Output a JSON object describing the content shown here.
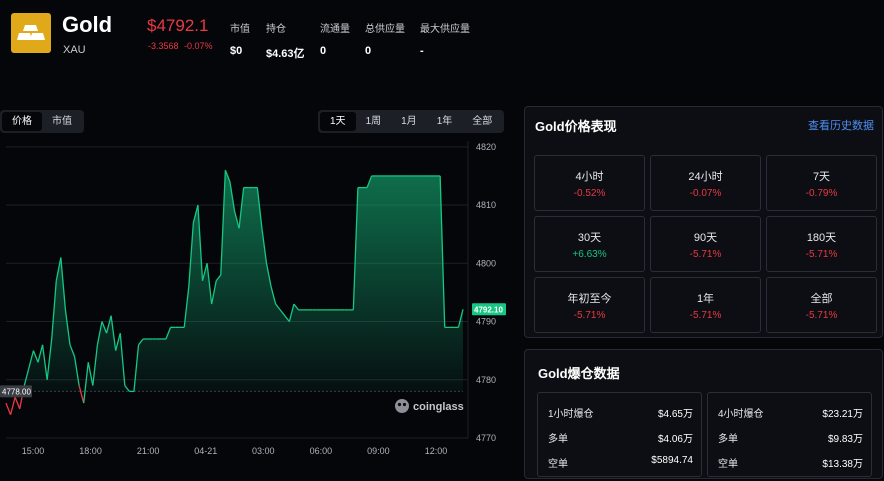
{
  "header": {
    "name": "Gold",
    "symbol": "XAU",
    "price": "$4792.1",
    "change_abs": "-3.3568",
    "change_pct": "-0.07%",
    "stats": [
      {
        "label": "市值",
        "value": "$0"
      },
      {
        "label": "持仓",
        "value": "$4.63亿"
      },
      {
        "label": "流通量",
        "value": "0"
      },
      {
        "label": "总供应量",
        "value": "0"
      },
      {
        "label": "最大供应量",
        "value": "-"
      }
    ]
  },
  "chart_tabs": {
    "price": "价格",
    "market_cap": "市值"
  },
  "range_tabs": [
    "1天",
    "1周",
    "1月",
    "1年",
    "全部"
  ],
  "watermark": "coinglass",
  "chart_data": {
    "type": "area",
    "x_ticks": [
      "15:00",
      "18:00",
      "21:00",
      "04-21",
      "03:00",
      "06:00",
      "09:00",
      "12:00"
    ],
    "y_ticks": [
      4820,
      4810,
      4800,
      4790,
      4780,
      4770
    ],
    "ylim": [
      4770,
      4821
    ],
    "baseline": 4778.0,
    "baseline_label": "4778.00",
    "last_label": "4792.10",
    "values": [
      4776,
      4774,
      4777,
      4775,
      4779,
      4782,
      4785,
      4783,
      4786,
      4780,
      4787,
      4797,
      4801,
      4792,
      4786,
      4784,
      4779,
      4776,
      4783,
      4779,
      4786,
      4790,
      4788,
      4791,
      4785,
      4788,
      4779,
      4778,
      4778,
      4786,
      4787,
      4787,
      4787,
      4787,
      4787,
      4787,
      4789,
      4789,
      4789,
      4789,
      4796,
      4807,
      4810,
      4797,
      4800,
      4793,
      4797,
      4798,
      4816,
      4814,
      4809,
      4806,
      4813,
      4813,
      4813,
      4813,
      4806,
      4800,
      4796,
      4793,
      4792,
      4791,
      4790,
      4793,
      4792,
      4792,
      4792,
      4792,
      4792,
      4792,
      4792,
      4792,
      4792,
      4792,
      4792,
      4792,
      4792,
      4813,
      4813,
      4813,
      4815,
      4815,
      4815,
      4815,
      4815,
      4815,
      4815,
      4815,
      4815,
      4815,
      4815,
      4815,
      4815,
      4815,
      4815,
      4815,
      4789,
      4789,
      4789,
      4789,
      4792.1
    ]
  },
  "performance": {
    "title": "Gold价格表现",
    "history_link": "查看历史数据",
    "cells": [
      {
        "label": "4小时",
        "value": "-0.52%",
        "color": "#ea3943"
      },
      {
        "label": "24小时",
        "value": "-0.07%",
        "color": "#ea3943"
      },
      {
        "label": "7天",
        "value": "-0.79%",
        "color": "#ea3943"
      },
      {
        "label": "30天",
        "value": "+6.63%",
        "color": "#16c784"
      },
      {
        "label": "90天",
        "value": "-5.71%",
        "color": "#ea3943"
      },
      {
        "label": "180天",
        "value": "-5.71%",
        "color": "#ea3943"
      },
      {
        "label": "年初至今",
        "value": "-5.71%",
        "color": "#ea3943"
      },
      {
        "label": "1年",
        "value": "-5.71%",
        "color": "#ea3943"
      },
      {
        "label": "全部",
        "value": "-5.71%",
        "color": "#ea3943"
      }
    ]
  },
  "liquidation": {
    "title": "Gold爆仓数据",
    "boxes": [
      {
        "period": "1小时爆仓",
        "total": "$4.65万",
        "long_label": "多单",
        "long": "$4.06万",
        "short_label": "空单",
        "short": "$5894.74"
      },
      {
        "period": "4小时爆仓",
        "total": "$23.21万",
        "long_label": "多单",
        "long": "$9.83万",
        "short_label": "空单",
        "short": "$13.38万"
      }
    ]
  },
  "colors": {
    "up": "#16c784",
    "down": "#ea3943",
    "accent": "#4e8ff2",
    "gold": "#e0a91a"
  }
}
